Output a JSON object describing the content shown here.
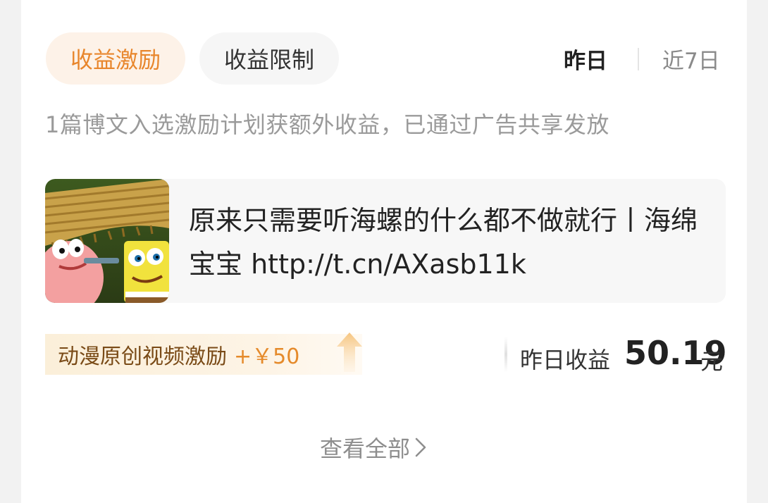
{
  "tabs": {
    "incentive": "收益激励",
    "limit": "收益限制"
  },
  "period": {
    "yesterday": "昨日",
    "last7": "近7日"
  },
  "description": "1篇博文入选激励计划获额外收益，已通过广告共享发放",
  "post": {
    "title": "原来只需要听海螺的什么都不做就行丨海绵宝宝 http://t.cn/AXasb11k"
  },
  "badge": {
    "label": "动漫原创视频激励",
    "bonus": "+￥50"
  },
  "earnings": {
    "label": "昨日收益",
    "value": "50.19",
    "unit": "元"
  },
  "view_all": "查看全部",
  "colors": {
    "accent": "#e8862c",
    "badge_bg": "#fbefd9",
    "card_bg": "#ffffff"
  }
}
